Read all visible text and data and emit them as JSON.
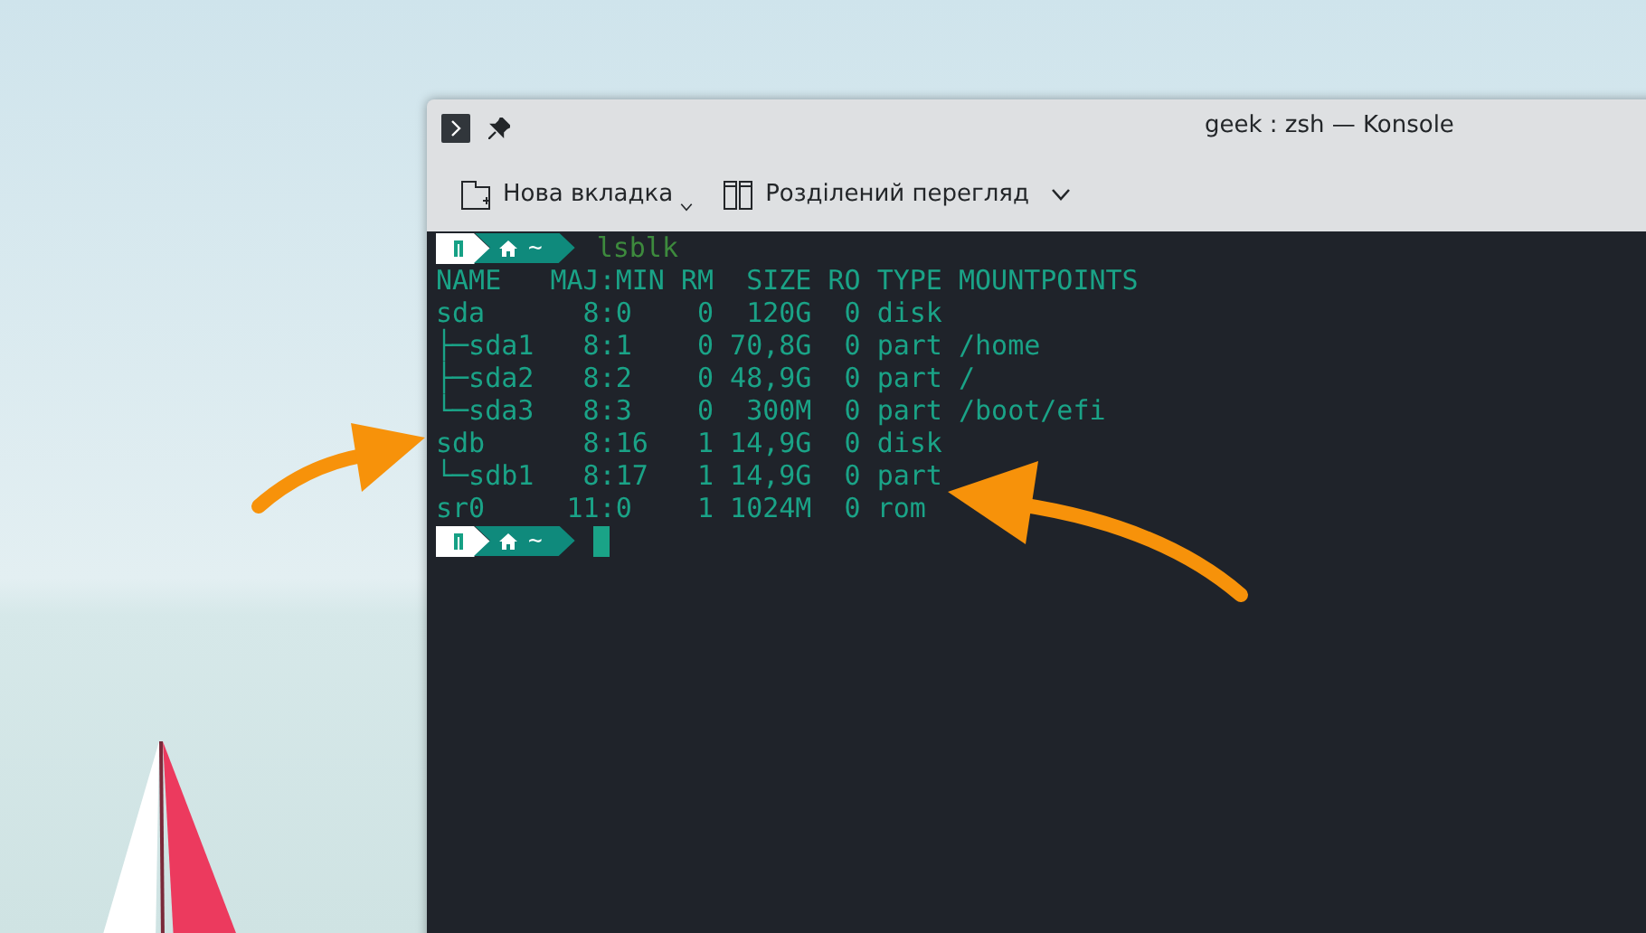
{
  "window": {
    "title": "geek : zsh — Konsole"
  },
  "toolbar": [
    {
      "label": "Нова вкладка",
      "kind": "new-tab",
      "menu": true
    },
    {
      "label": "Розділений перегляд",
      "kind": "split",
      "menu": true
    }
  ],
  "terminal": {
    "lines": [
      {
        "kind": "prompt",
        "path": "~",
        "command": "lsblk"
      },
      {
        "kind": "output",
        "text": "NAME   MAJ:MIN RM  SIZE RO TYPE MOUNTPOINTS"
      },
      {
        "kind": "output",
        "text": "sda      8:0    0  120G  0 disk"
      },
      {
        "kind": "output",
        "text": "├─sda1   8:1    0 70,8G  0 part /home"
      },
      {
        "kind": "output",
        "text": "├─sda2   8:2    0 48,9G  0 part /"
      },
      {
        "kind": "output",
        "text": "└─sda3   8:3    0  300M  0 part /boot/efi"
      },
      {
        "kind": "output",
        "text": "sdb      8:16   1 14,9G  0 disk"
      },
      {
        "kind": "output",
        "text": "└─sdb1   8:17   1 14,9G  0 part"
      },
      {
        "kind": "output",
        "text": "sr0     11:0    1 1024M  0 rom"
      },
      {
        "kind": "prompt",
        "path": "~",
        "cursor": true
      }
    ]
  }
}
